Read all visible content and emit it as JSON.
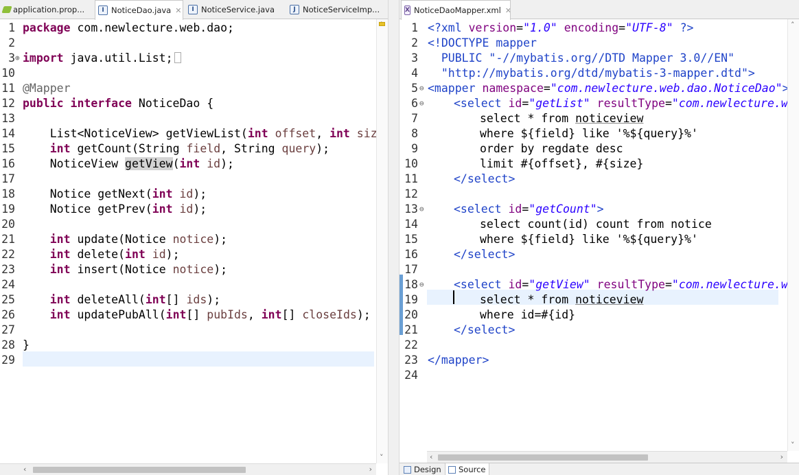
{
  "left_editor": {
    "tabs": [
      {
        "label": "application.prop...",
        "icon": "properties-file-icon"
      },
      {
        "label": "NoticeDao.java",
        "icon": "java-interface-icon",
        "active": true,
        "close": "✕"
      },
      {
        "label": "NoticeService.java",
        "icon": "java-interface-icon"
      },
      {
        "label": "NoticeServiceImp...",
        "icon": "java-class-icon"
      }
    ],
    "line_numbers": [
      "1",
      "2",
      "3",
      "10",
      "11",
      "12",
      "13",
      "14",
      "15",
      "16",
      "17",
      "18",
      "19",
      "20",
      "21",
      "22",
      "23",
      "24",
      "25",
      "26",
      "27",
      "28",
      "29"
    ],
    "lines": {
      "l1": {
        "kw": "package",
        "rest": " com.newlecture.web.dao;"
      },
      "l3": {
        "kw": "import",
        "rest": " java.util.List;"
      },
      "l11": "@Mapper",
      "l12": {
        "kw1": "public",
        "kw2": "interface",
        "rest": " NoticeDao {"
      },
      "l14": {
        "pre": "    List<NoticeView> getViewList(",
        "kw1": "int",
        "p1": " offset",
        "sep": ", ",
        "kw2": "int",
        "p2": " size,"
      },
      "l15": {
        "kw": "int",
        "pre": " getCount(String ",
        "p1": "field",
        "mid": ", String ",
        "p2": "query",
        "post": ");"
      },
      "l16": {
        "pre": "    NoticeView ",
        "hl": "getView",
        "mid": "(",
        "kw": "int",
        "p": " id",
        "post": ");"
      },
      "l18": {
        "pre": "    Notice getNext(",
        "kw": "int",
        "p": " id",
        "post": ");"
      },
      "l19": {
        "pre": "    Notice getPrev(",
        "kw": "int",
        "p": " id",
        "post": ");"
      },
      "l21": {
        "kw": "int",
        "pre": " update(Notice ",
        "p": "notice",
        "post": ");"
      },
      "l22": {
        "kw": "int",
        "pre": " delete(",
        "kw2": "int",
        "p": " id",
        "post": ");"
      },
      "l23": {
        "kw": "int",
        "pre": " insert(Notice ",
        "p": "notice",
        "post": ");"
      },
      "l25": {
        "kw": "int",
        "pre": " deleteAll(",
        "kw2": "int",
        "mid": "[] ",
        "p": "ids",
        "post": ");"
      },
      "l26": {
        "kw": "int",
        "pre": " updatePubAll(",
        "kw2": "int",
        "mid": "[] ",
        "p1": "pubIds",
        "sep": ", ",
        "kw3": "int",
        "mid2": "[] ",
        "p2": "closeIds",
        "post": ");"
      },
      "l28": "}"
    }
  },
  "right_editor": {
    "tab": {
      "label": "NoticeDaoMapper.xml",
      "icon": "xml-file-icon",
      "close": "✕"
    },
    "line_numbers": [
      "1",
      "2",
      "3",
      "4",
      "5",
      "6",
      "7",
      "8",
      "9",
      "10",
      "11",
      "12",
      "13",
      "14",
      "15",
      "16",
      "17",
      "18",
      "19",
      "20",
      "21",
      "22",
      "23",
      "24"
    ],
    "lines": {
      "r1": {
        "a": "<?xml ",
        "b": "version",
        "c": "=",
        "d": "\"1.0\"",
        "e": " encoding",
        "f": "=",
        "g": "\"UTF-8\"",
        "h": " ?>"
      },
      "r2": "<!DOCTYPE mapper",
      "r3": "  PUBLIC \"-//mybatis.org//DTD Mapper 3.0//EN\"",
      "r4": "  \"http://mybatis.org/dtd/mybatis-3-mapper.dtd\">",
      "r5": {
        "a": "<mapper",
        "b": " namespace",
        "c": "=",
        "d": "\"com.newlecture.web.dao.NoticeDao\"",
        "e": ">"
      },
      "r6": {
        "a": "<select",
        "b": " id",
        "c": "=",
        "d": "\"getList\"",
        "e": " resultType",
        "f": "=",
        "g": "\"com.newlecture.we"
      },
      "r7": "select * from ",
      "r7b": "noticeview",
      "r8": "where ${field} like '%${query}%'",
      "r9": "order by regdate desc",
      "r10": "limit #{offset}, #{size}",
      "r11": "</select>",
      "r13": {
        "a": "<select",
        "b": " id",
        "c": "=",
        "d": "\"getCount\"",
        "e": ">"
      },
      "r14": "select count(id) count from notice",
      "r15": "where ${field} like '%${query}%'",
      "r16": "</select>",
      "r18": {
        "a": "<select",
        "b": " id",
        "c": "=",
        "d": "\"getView\"",
        "e": " resultType",
        "f": "=",
        "g": "\"com.newlecture.we"
      },
      "r19": "select * from ",
      "r19b": "noticeview",
      "r20": "where id=#{id}",
      "r21": "</select>",
      "r23": "</mapper>"
    },
    "bottom_tabs": [
      {
        "label": "Design",
        "icon": "design-icon"
      },
      {
        "label": "Source",
        "icon": "source-icon",
        "active": true
      }
    ]
  },
  "scroll_arrows": {
    "left": "‹",
    "right": "›",
    "up": "˄",
    "down": "˅"
  },
  "colors": {
    "keyword": "#7f0055",
    "param": "#6a3e3e",
    "xml_tag": "#1f43c8",
    "xml_attr": "#7f007f",
    "xml_value": "#2a00ff",
    "current_line": "#e8f2fe"
  }
}
